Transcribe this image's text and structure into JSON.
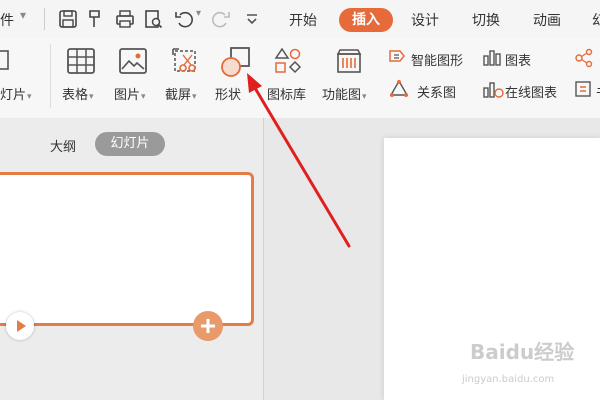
{
  "tabs": {
    "left_truncated": "件",
    "items": [
      "开始",
      "插入",
      "设计",
      "切换",
      "动画"
    ],
    "active": "插入",
    "right_truncated": "幻"
  },
  "ribbon": {
    "new_slide": "灯片",
    "table": "表格",
    "picture": "图片",
    "screenshot": "截屏",
    "shape": "形状",
    "icon_library": "图标库",
    "function_chart": "功能图",
    "smart_shape": "智能图形",
    "chart": "图表",
    "relation_chart": "关系图",
    "online_chart": "在线图表",
    "right_truncated": "书"
  },
  "sidebar": {
    "outline_tab": "大纲",
    "slides_tab": "幻灯片"
  },
  "watermark": {
    "brand": "Baidu经验",
    "url": "jingyan.baidu.com"
  },
  "colors": {
    "accent": "#e66a3a",
    "arrow": "#e01f1f"
  }
}
